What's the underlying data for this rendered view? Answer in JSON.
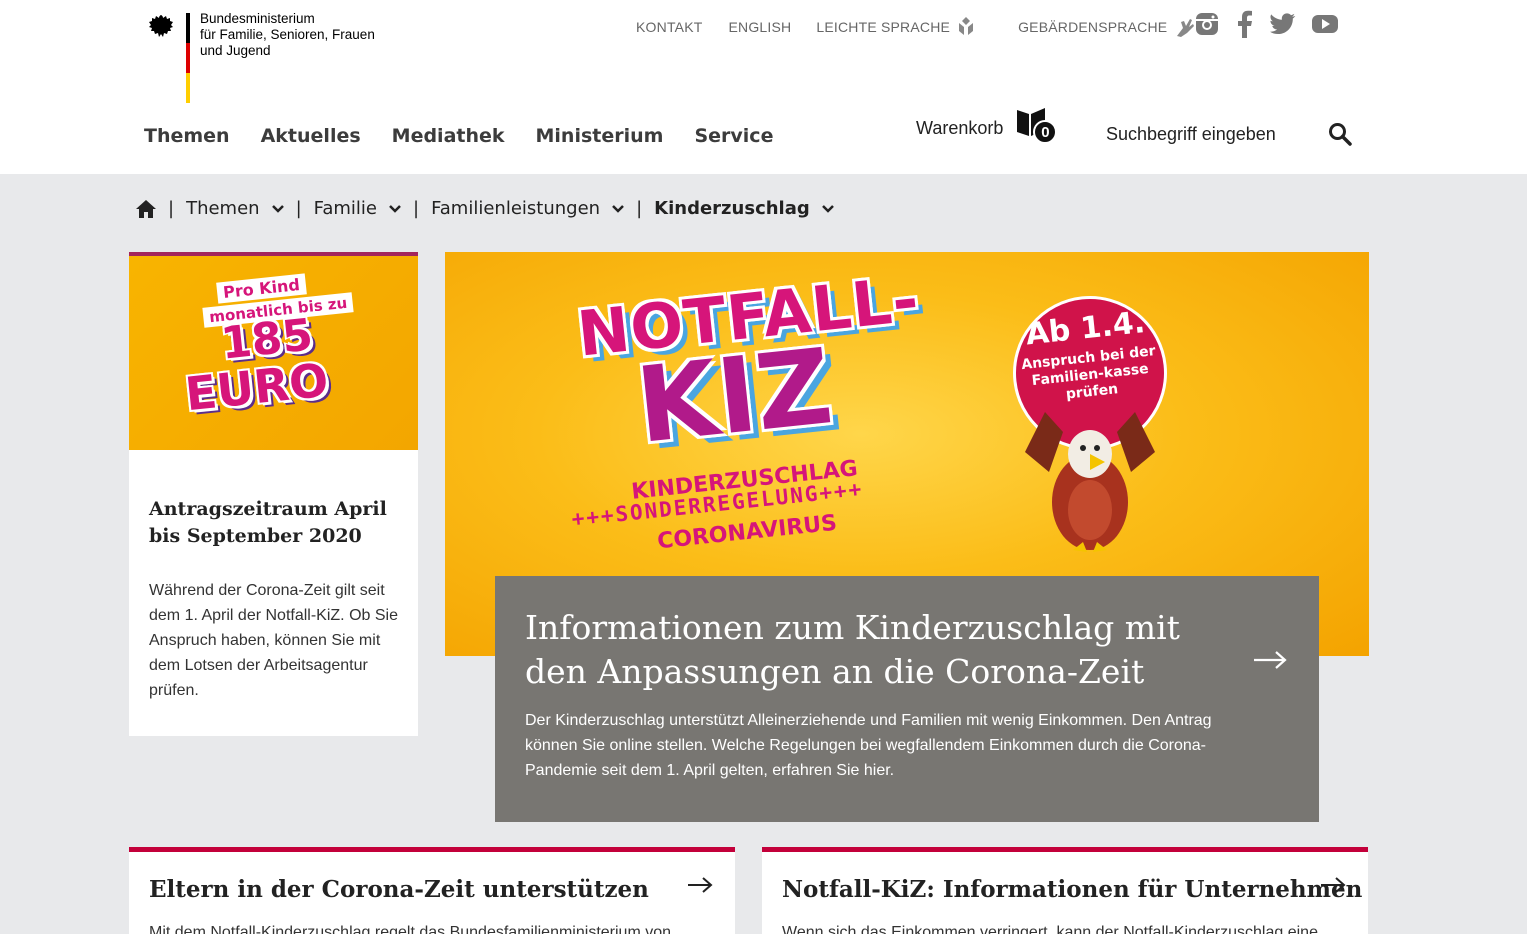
{
  "header": {
    "logo_text": "Bundesministerium\nfür Familie, Senioren, Frauen\nund Jugend",
    "flag_colors": [
      "#000000",
      "#dd0000",
      "#ffce00"
    ],
    "utility": {
      "kontakt": "KONTAKT",
      "english": "ENGLISH",
      "leichte_sprache": "LEICHTE SPRACHE",
      "gebaerdensprache": "GEBÄRDENSPRACHE"
    },
    "social_icons": [
      "instagram-icon",
      "facebook-icon",
      "twitter-icon",
      "youtube-icon"
    ],
    "nav": [
      "Themen",
      "Aktuelles",
      "Mediathek",
      "Ministerium",
      "Service"
    ],
    "cart": {
      "label": "Warenkorb",
      "count": "0"
    },
    "search": {
      "placeholder": "Suchbegriff eingeben"
    }
  },
  "breadcrumb": {
    "items": [
      "Themen",
      "Familie",
      "Familienleistungen"
    ],
    "current": "Kinderzuschlag"
  },
  "promo": {
    "image_text": {
      "line1": "Pro Kind",
      "line2": "monatlich bis zu",
      "big1": "185",
      "big2": "EURO"
    },
    "title": "Antragszeitraum April bis September 2020",
    "text": "Während der Corona-Zeit gilt seit dem 1. April der Notfall-KiZ. Ob Sie Anspruch haben, können Sie mit dem Lotsen der Arbeitsagentur prüfen."
  },
  "hero": {
    "image_text": {
      "title1": "NOTFALL-",
      "title2": "KIZ",
      "sub1": "KINDERZUSCHLAG",
      "sub2": "+++SONDERREGELUNG+++",
      "sub3": "CORONAVIRUS",
      "sign_date": "Ab 1.4.",
      "sign_text": "Anspruch bei der Familien-kasse prüfen"
    },
    "title": "Informationen zum Kinderzuschlag mit den Anpassungen an die Corona-Zeit",
    "text": "Der Kinderzuschlag unterstützt Alleinerziehende und Familien mit wenig Einkommen. Den Antrag können Sie online stellen. Welche Regelungen bei wegfallendem Einkommen durch die Corona-Pandemie seit dem 1. April gelten, erfahren Sie hier."
  },
  "cards": [
    {
      "title": "Eltern in der Corona-Zeit unterstützen",
      "text": "Mit dem Notfall-Kinderzuschlag regelt das Bundesfamilienministerium von"
    },
    {
      "title": "Notfall-KiZ: Informationen für Unternehmen",
      "text": "Wenn sich das Einkommen verringert, kann der Notfall-Kinderzuschlag eine"
    }
  ],
  "colors": {
    "accent_magenta": "#d6157a",
    "card_border": "#c3003a",
    "promo_border": "#a3245c",
    "hero_box": "#787672",
    "page_bg": "#e8e9eb"
  }
}
